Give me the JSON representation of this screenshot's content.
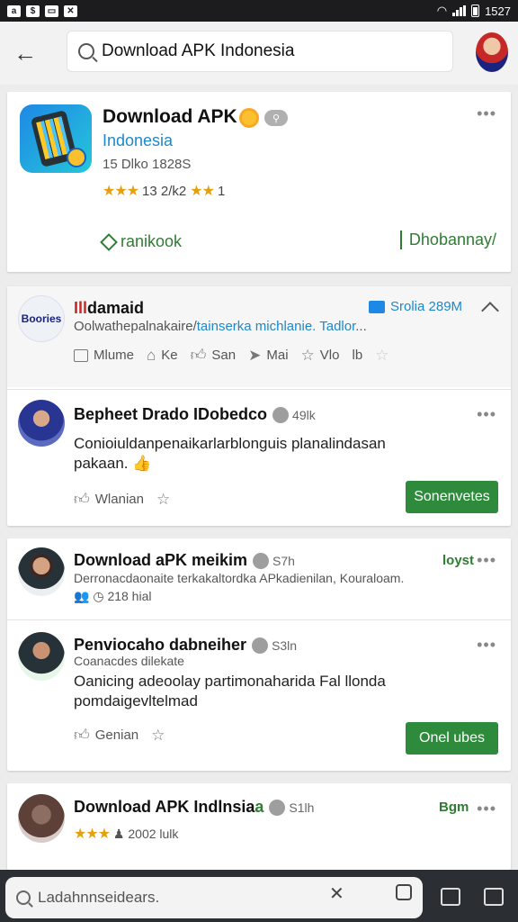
{
  "status_bar": {
    "time": "1527"
  },
  "search": {
    "query": "Download APK Indonesia"
  },
  "featured": {
    "title": "Download APK",
    "subtitle": "Indonesia",
    "meta": "15 Dlko 1828S",
    "rating_text": "13 2/k2 ",
    "rating_tail": "1",
    "link_left": "ranikook",
    "link_right": "Dhobannay/"
  },
  "card2": {
    "logo_text": "Boories",
    "title_red": "Ill",
    "title_rest": "damaid",
    "tag": "Srolia 289M",
    "desc_dark": "Oolwathepalnakaire/",
    "desc_link": "tainserka michlanie. Tadlor",
    "desc_tail": "...",
    "actions": [
      "Mlume",
      "Ke",
      "San",
      "Mai",
      "Vlo",
      "lb"
    ]
  },
  "post1": {
    "title": "Bepheet Drado IDobedco",
    "time": "49lk",
    "body": "Conioiuldanpenaikarlarblonguis planalindasan pakaan.",
    "action": "Wlanian",
    "button": "Sonenvetes"
  },
  "post2": {
    "title": "Download aPK meikim",
    "time": "S7h",
    "right": "loyst",
    "sub": "Derronacdaonaite terkakaltordka APkadienilan, Kouraloam.",
    "stats": "218 hial"
  },
  "post3": {
    "title": "Penviocaho dabneiher",
    "time": "S3ln",
    "sub": "Coanacdes dilekate",
    "body": "Oanicing adeoolay partimonaharida  Fal llonda pomdaigevltelmad",
    "action": "Genian",
    "button": "Onel ubes"
  },
  "post4": {
    "title_black": "Download APK Indlnsia",
    "title_green": "a",
    "time": "S1lh",
    "right": "Bgm",
    "stats": "2002 lulk"
  },
  "bottom_bar": {
    "placeholder": "Ladahnnseidears."
  }
}
